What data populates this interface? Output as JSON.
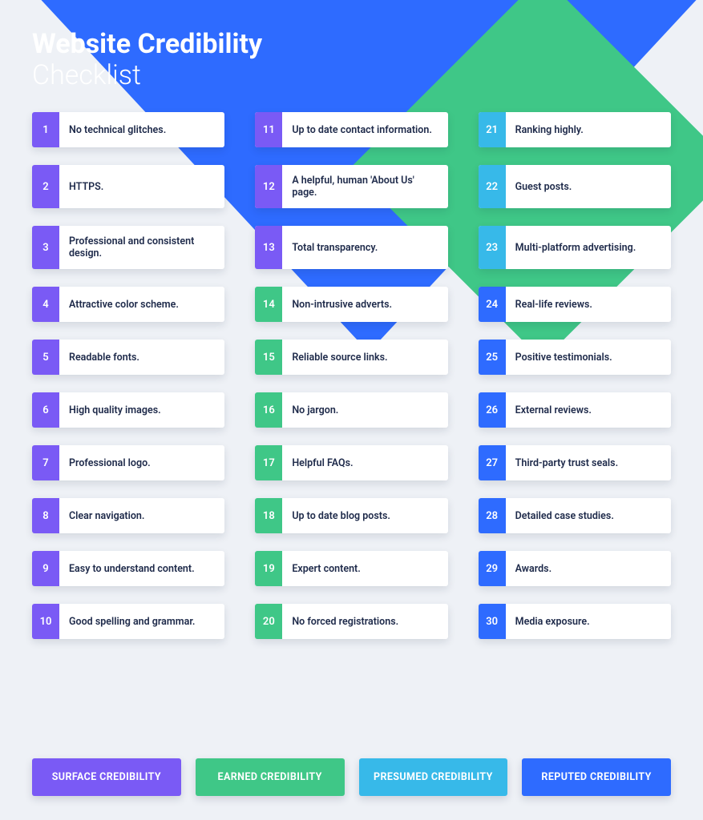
{
  "title": {
    "bold": "Website Credibility",
    "light": "Checklist"
  },
  "colors": {
    "purple": "#7a5af5",
    "green": "#3fc787",
    "cyan": "#37b9e9",
    "blue": "#2e6bff"
  },
  "items": [
    {
      "n": "1",
      "label": "No technical glitches.",
      "color": "purple"
    },
    {
      "n": "2",
      "label": "HTTPS.",
      "color": "purple"
    },
    {
      "n": "3",
      "label": "Professional and consistent design.",
      "color": "purple"
    },
    {
      "n": "4",
      "label": "Attractive color scheme.",
      "color": "purple"
    },
    {
      "n": "5",
      "label": "Readable fonts.",
      "color": "purple"
    },
    {
      "n": "6",
      "label": "High quality images.",
      "color": "purple"
    },
    {
      "n": "7",
      "label": "Professional logo.",
      "color": "purple"
    },
    {
      "n": "8",
      "label": "Clear navigation.",
      "color": "purple"
    },
    {
      "n": "9",
      "label": "Easy to understand content.",
      "color": "purple"
    },
    {
      "n": "10",
      "label": "Good spelling and grammar.",
      "color": "purple"
    },
    {
      "n": "11",
      "label": "Up to date contact information.",
      "color": "purple"
    },
    {
      "n": "12",
      "label": "A helpful, human 'About Us' page.",
      "color": "purple"
    },
    {
      "n": "13",
      "label": "Total transparency.",
      "color": "purple"
    },
    {
      "n": "14",
      "label": "Non-intrusive adverts.",
      "color": "green"
    },
    {
      "n": "15",
      "label": "Reliable source links.",
      "color": "green"
    },
    {
      "n": "16",
      "label": "No jargon.",
      "color": "green"
    },
    {
      "n": "17",
      "label": "Helpful FAQs.",
      "color": "green"
    },
    {
      "n": "18",
      "label": "Up to date blog posts.",
      "color": "green"
    },
    {
      "n": "19",
      "label": "Expert content.",
      "color": "green"
    },
    {
      "n": "20",
      "label": "No forced registrations.",
      "color": "green"
    },
    {
      "n": "21",
      "label": "Ranking highly.",
      "color": "cyan"
    },
    {
      "n": "22",
      "label": "Guest posts.",
      "color": "cyan"
    },
    {
      "n": "23",
      "label": "Multi-platform advertising.",
      "color": "cyan"
    },
    {
      "n": "24",
      "label": "Real-life reviews.",
      "color": "blue"
    },
    {
      "n": "25",
      "label": "Positive testimonials.",
      "color": "blue"
    },
    {
      "n": "26",
      "label": "External reviews.",
      "color": "blue"
    },
    {
      "n": "27",
      "label": "Third-party trust seals.",
      "color": "blue"
    },
    {
      "n": "28",
      "label": "Detailed case studies.",
      "color": "blue"
    },
    {
      "n": "29",
      "label": "Awards.",
      "color": "blue"
    },
    {
      "n": "30",
      "label": "Media exposure.",
      "color": "blue"
    }
  ],
  "legend": [
    {
      "label": "SURFACE CREDIBILITY",
      "color": "purple"
    },
    {
      "label": "EARNED CREDIBILITY",
      "color": "green"
    },
    {
      "label": "PRESUMED CREDIBILITY",
      "color": "cyan"
    },
    {
      "label": "REPUTED CREDIBILITY",
      "color": "blue"
    }
  ]
}
